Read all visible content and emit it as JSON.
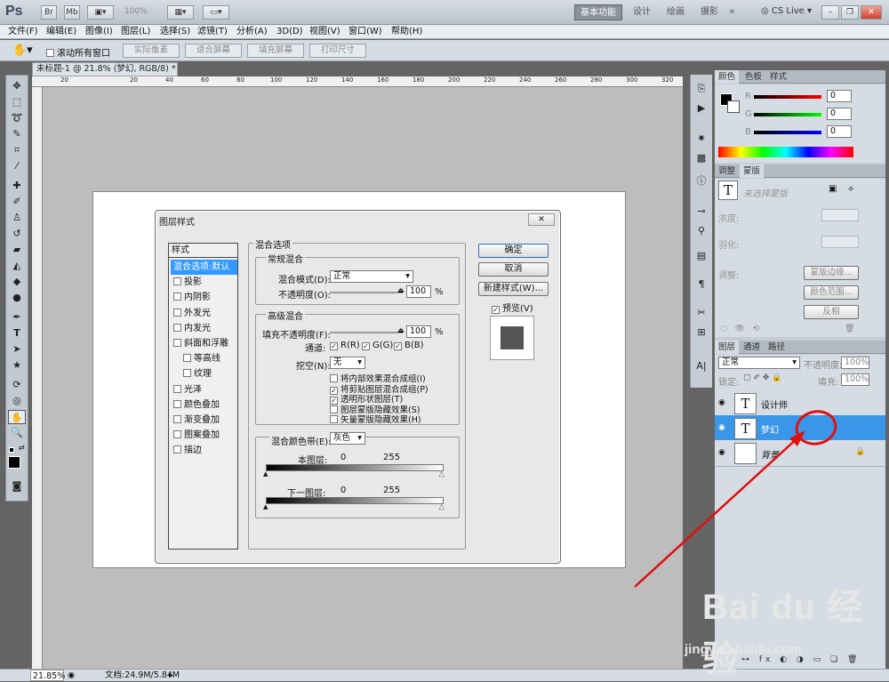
{
  "app": {
    "logo": "Ps",
    "zoom_readout": "100%",
    "cs_live": "CS Live"
  },
  "workspaces": [
    {
      "label": "基本功能",
      "active": true
    },
    {
      "label": "设计",
      "active": false
    },
    {
      "label": "绘画",
      "active": false
    },
    {
      "label": "摄影",
      "active": false
    }
  ],
  "menubar": [
    "文件(F)",
    "编辑(E)",
    "图像(I)",
    "图层(L)",
    "选择(S)",
    "滤镜(T)",
    "分析(A)",
    "3D(D)",
    "视图(V)",
    "窗口(W)",
    "帮助(H)"
  ],
  "options": {
    "scroll_all": "滚动所有窗口",
    "actual_pixels": "实际像素",
    "fit_screen": "适合屏幕",
    "fill_screen": "填充屏幕",
    "print_size": "打印尺寸"
  },
  "document": {
    "tab_title": "未标题-1 @ 21.8% (梦幻, RGB/8) *",
    "ruler_ticks": [
      "20",
      "0",
      "20",
      "40",
      "60",
      "80",
      "100",
      "120",
      "140",
      "160",
      "180",
      "200",
      "220",
      "240",
      "260",
      "280",
      "300",
      "320"
    ]
  },
  "status": {
    "zoom": "21.85%",
    "doc_size": "文档:24.9M/5.84M"
  },
  "dialog": {
    "title": "图层样式",
    "styles_header": "样式",
    "style_items": [
      {
        "label": "混合选项:默认",
        "checkbox": false,
        "selected": true,
        "indent": false
      },
      {
        "label": "投影",
        "checkbox": true,
        "selected": false,
        "indent": false
      },
      {
        "label": "内阴影",
        "checkbox": true,
        "selected": false,
        "indent": false
      },
      {
        "label": "外发光",
        "checkbox": true,
        "selected": false,
        "indent": false
      },
      {
        "label": "内发光",
        "checkbox": true,
        "selected": false,
        "indent": false
      },
      {
        "label": "斜面和浮雕",
        "checkbox": true,
        "selected": false,
        "indent": false
      },
      {
        "label": "等高线",
        "checkbox": true,
        "selected": false,
        "indent": true
      },
      {
        "label": "纹理",
        "checkbox": true,
        "selected": false,
        "indent": true
      },
      {
        "label": "光泽",
        "checkbox": true,
        "selected": false,
        "indent": false
      },
      {
        "label": "颜色叠加",
        "checkbox": true,
        "selected": false,
        "indent": false
      },
      {
        "label": "渐变叠加",
        "checkbox": true,
        "selected": false,
        "indent": false
      },
      {
        "label": "图案叠加",
        "checkbox": true,
        "selected": false,
        "indent": false
      },
      {
        "label": "描边",
        "checkbox": true,
        "selected": false,
        "indent": false
      }
    ],
    "blend_options": "混合选项",
    "general_blend": "常规混合",
    "blend_mode_label": "混合模式(D):",
    "blend_mode_value": "正常",
    "opacity_label": "不透明度(O):",
    "opacity_value": "100",
    "percent": "%",
    "advanced_blend": "高级混合",
    "fill_opacity_label": "填充不透明度(F):",
    "fill_opacity_value": "100",
    "channels_label": "通道:",
    "channel_r": "R(R)",
    "channel_g": "G(G)",
    "channel_b": "B(B)",
    "knockout_label": "挖空(N):",
    "knockout_value": "无",
    "adv_options": [
      {
        "label": "将内部效果混合成组(I)",
        "checked": false
      },
      {
        "label": "将剪贴图层混合成组(P)",
        "checked": true
      },
      {
        "label": "透明形状图层(T)",
        "checked": true
      },
      {
        "label": "图层蒙版隐藏效果(S)",
        "checked": false
      },
      {
        "label": "矢量蒙版隐藏效果(H)",
        "checked": false
      }
    ],
    "blend_if_label": "混合颜色带(E):",
    "blend_if_value": "灰色",
    "this_layer": "本图层:",
    "underlying": "下一图层:",
    "range_min": "0",
    "range_max": "255",
    "ok": "确定",
    "cancel": "取消",
    "new_style": "新建样式(W)...",
    "preview": "预览(V)"
  },
  "color_panel": {
    "tabs": [
      "颜色",
      "色板",
      "样式"
    ],
    "r": "0",
    "g": "0",
    "b": "0",
    "labels": [
      "R",
      "G",
      "B"
    ]
  },
  "adjust_panel": {
    "tabs": [
      "调整",
      "蒙版"
    ],
    "no_mask": "未选择蒙版",
    "density": "浓度:",
    "feather": "羽化:",
    "refine": "调整:",
    "mask_edge": "蒙版边缘...",
    "color_range": "颜色范围...",
    "invert": "反相"
  },
  "layers_panel": {
    "tabs": [
      "图层",
      "通道",
      "路径"
    ],
    "blend_mode": "正常",
    "opacity_label": "不透明度:",
    "opacity_value": "100%",
    "lock_label": "锁定:",
    "fill_label": "填充:",
    "fill_value": "100%",
    "layers": [
      {
        "name": "设计师",
        "thumb": "T",
        "selected": false
      },
      {
        "name": "梦幻",
        "thumb": "T",
        "selected": true
      },
      {
        "name": "背景",
        "thumb": "",
        "selected": false
      }
    ]
  },
  "watermark": {
    "brand": "Bai du 经验",
    "url": "jingyan.baidu.com"
  },
  "colors": {
    "accent": "#3399ff",
    "annotation": "#e01010"
  }
}
